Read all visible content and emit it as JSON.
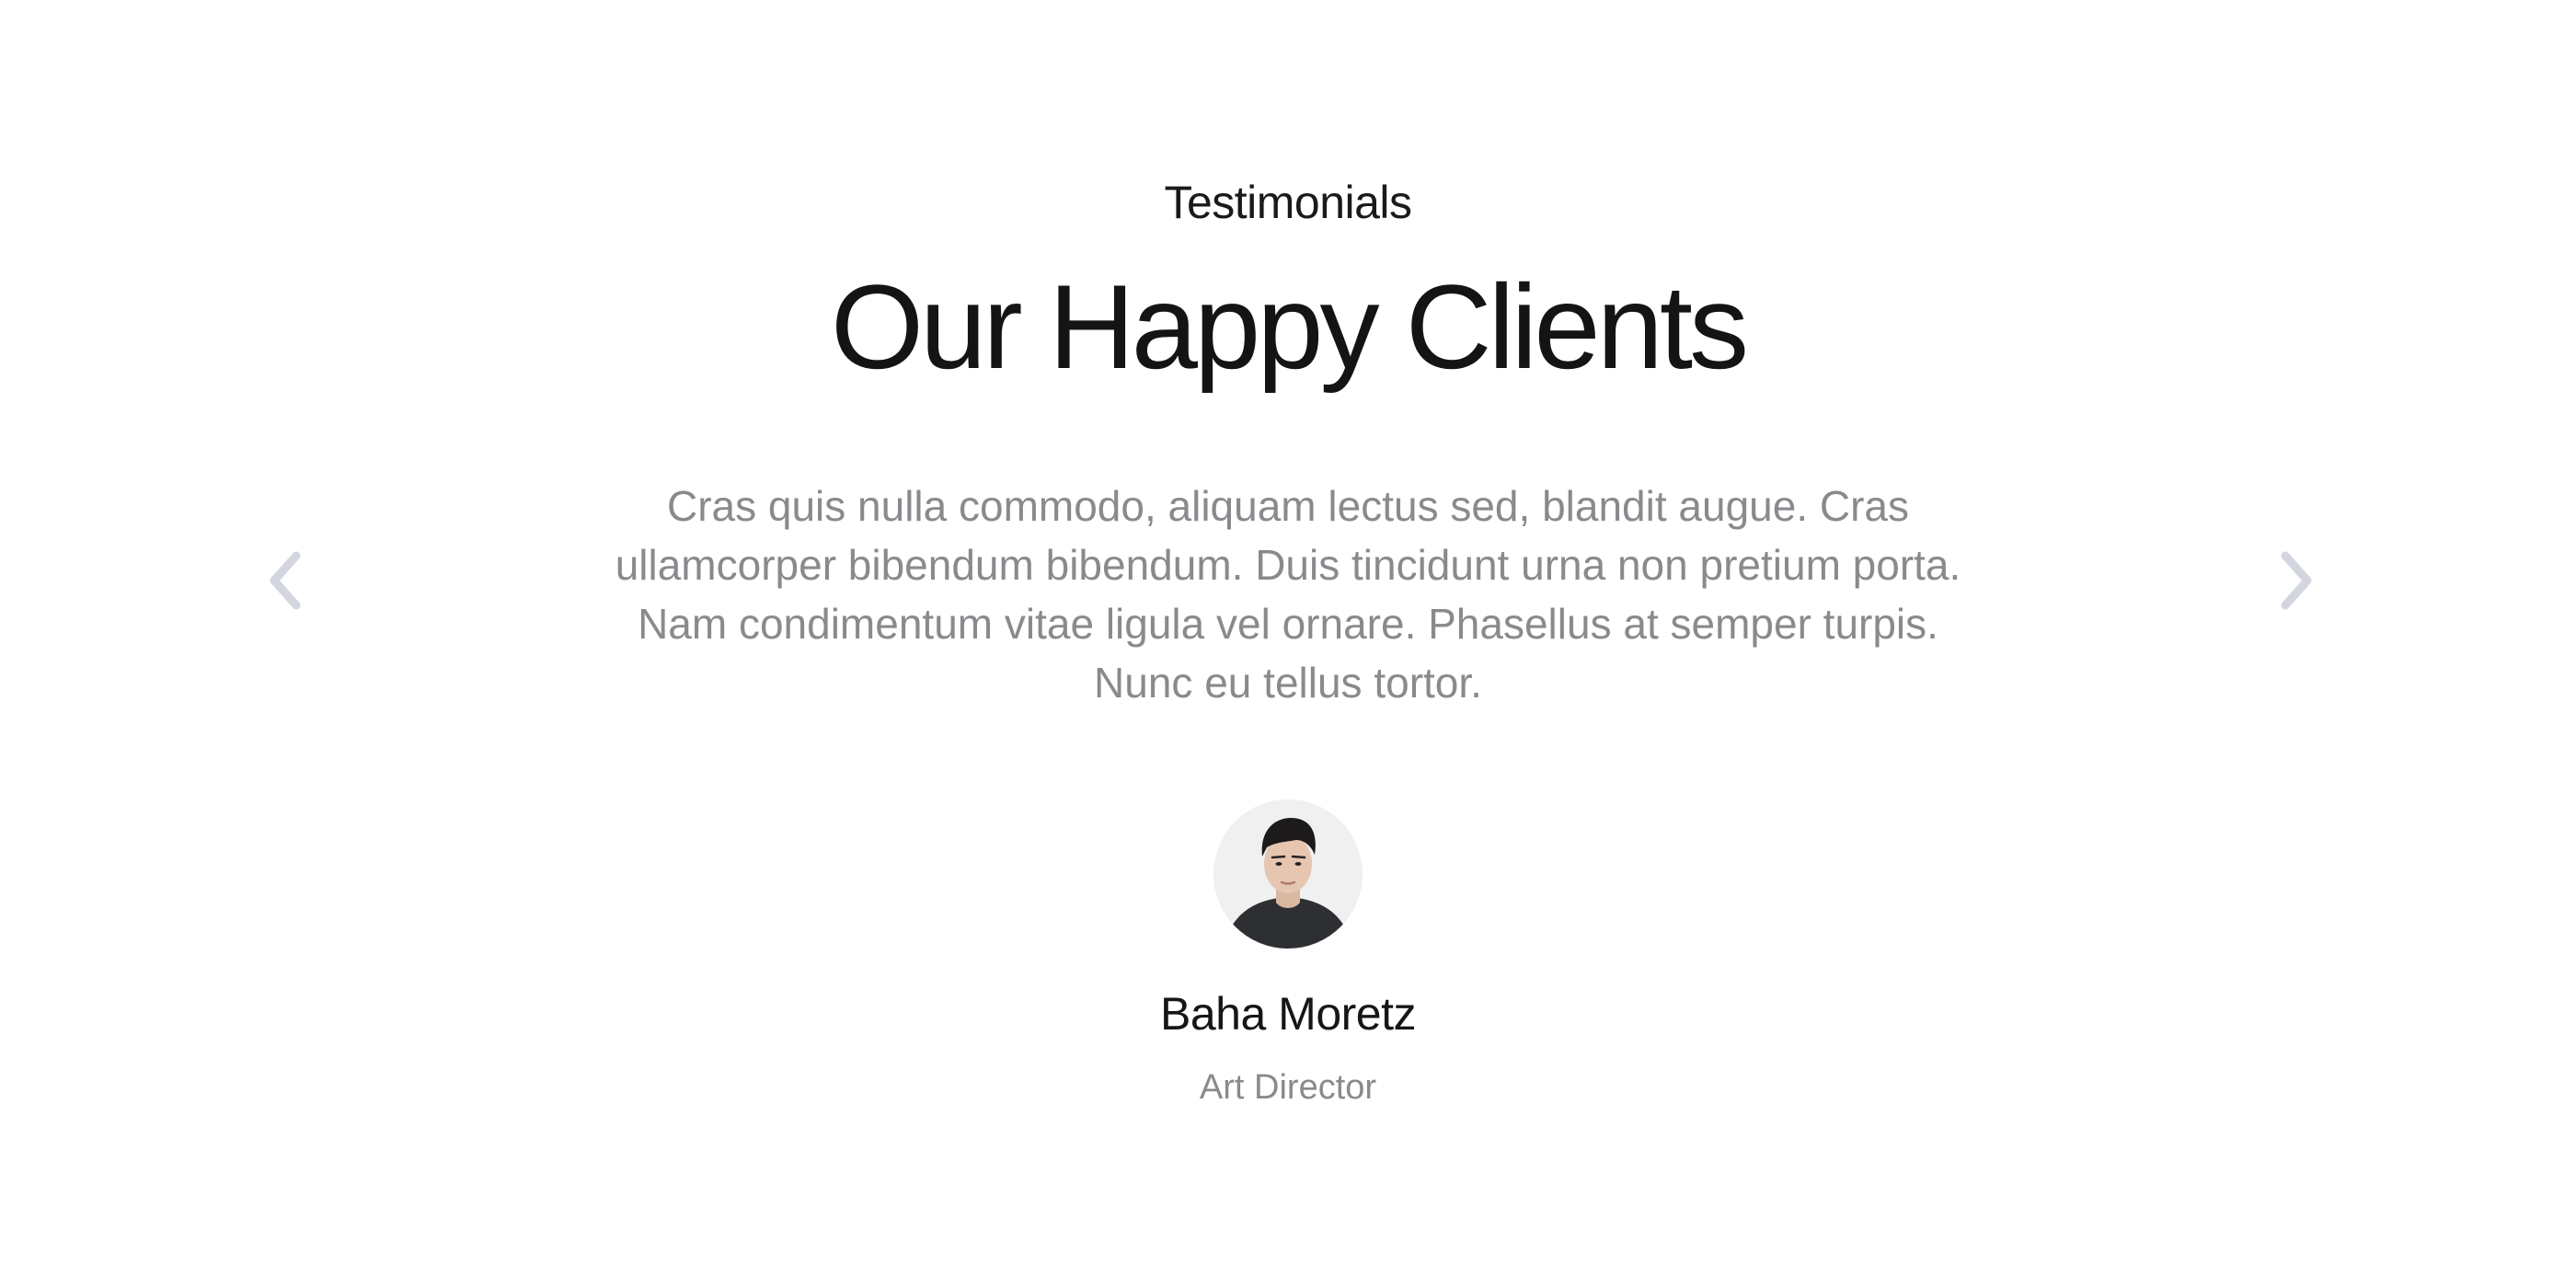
{
  "testimonials": {
    "eyebrow": "Testimonials",
    "title": "Our Happy Clients",
    "quote": "Cras quis nulla commodo, aliquam lectus sed, blandit augue. Cras ullamcorper bibendum bibendum. Duis tincidunt urna non pretium porta. Nam condimentum vitae ligula vel ornare. Phasellus at semper turpis. Nunc eu tellus tortor.",
    "author": {
      "name": "Baha Moretz",
      "role": "Art Director"
    },
    "navigation": {
      "prev_icon": "chevron-left-icon",
      "next_icon": "chevron-right-icon"
    }
  },
  "colors": {
    "heading": "#141414",
    "body_text": "#8a8a8e",
    "arrow": "#d3d6de",
    "background": "#ffffff"
  }
}
